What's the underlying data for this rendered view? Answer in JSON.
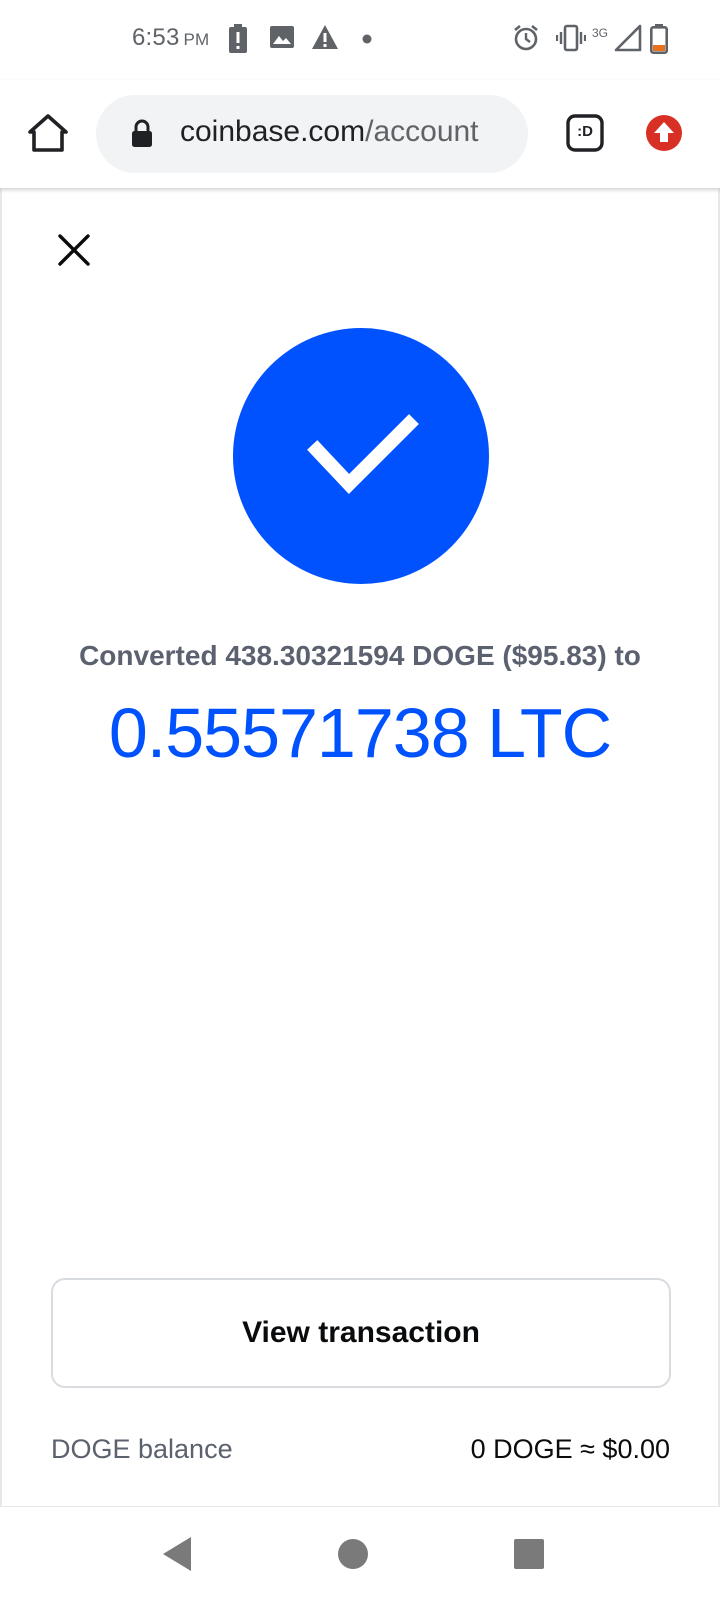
{
  "status_bar": {
    "time": "6:53",
    "ampm": "PM",
    "network": "3G"
  },
  "browser": {
    "url_domain": "coinbase.com",
    "url_path": "/account",
    "tabs_label": ":D"
  },
  "conversion": {
    "summary": "Converted 438.30321594 DOGE ($95.83) to",
    "result_amount": "0.55571738 LTC"
  },
  "actions": {
    "view_transaction_label": "View transaction"
  },
  "balance": {
    "label": "DOGE balance",
    "value": "0 DOGE ≈ $0.00"
  },
  "colors": {
    "brand_blue": "#0052ff",
    "text_secondary": "#5b616e",
    "update_red": "#d93025"
  },
  "icons": {
    "close": "close-icon",
    "success": "checkmark-icon",
    "home": "home-icon",
    "lock": "lock-icon",
    "update": "arrow-up-icon"
  }
}
